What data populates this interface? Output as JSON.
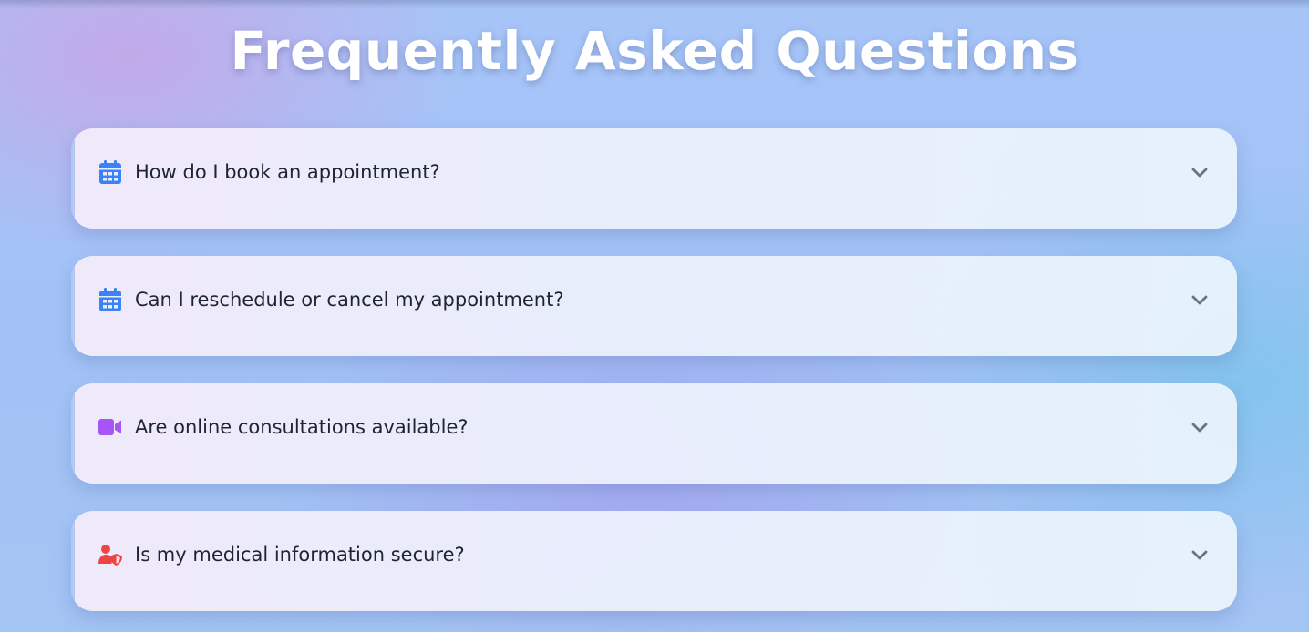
{
  "page": {
    "title": "Frequently Asked Questions"
  },
  "faq": {
    "items": [
      {
        "question": "How do I book an appointment?",
        "icon": "calendar-icon",
        "icon_color": "#3b82f6"
      },
      {
        "question": "Can I reschedule or cancel my appointment?",
        "icon": "calendar-icon",
        "icon_color": "#3b82f6"
      },
      {
        "question": "Are online consultations available?",
        "icon": "video-camera-icon",
        "icon_color": "#a855f7"
      },
      {
        "question": "Is my medical information secure?",
        "icon": "user-shield-icon",
        "icon_color": "#ef4444"
      }
    ]
  },
  "colors": {
    "chevron": "#6b7280",
    "question_text": "#1f2433",
    "title_text": "#ffffff"
  }
}
